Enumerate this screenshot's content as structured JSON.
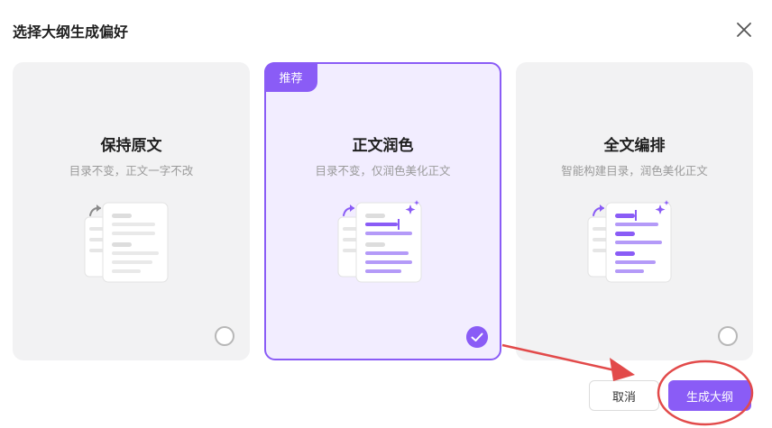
{
  "dialog": {
    "title": "选择大纲生成偏好",
    "close_icon": "close-icon"
  },
  "options": [
    {
      "title": "保持原文",
      "description": "目录不变，正文一字不改",
      "selected": false,
      "badge": ""
    },
    {
      "title": "正文润色",
      "description": "目录不变，仅润色美化正文",
      "selected": true,
      "badge": "推荐"
    },
    {
      "title": "全文编排",
      "description": "智能构建目录，润色美化正文",
      "selected": false,
      "badge": ""
    }
  ],
  "footer": {
    "cancel_label": "取消",
    "generate_label": "生成大纲"
  },
  "colors": {
    "accent": "#8a5cf6",
    "selected_bg": "#f2edff",
    "card_bg": "#f2f2f3",
    "annotation": "#e24a4a"
  }
}
